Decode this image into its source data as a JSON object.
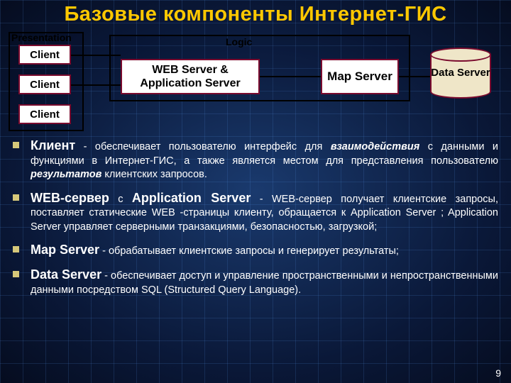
{
  "title": "Базовые компоненты Интернет-ГИС",
  "diagram": {
    "presentation_label": "Presentation",
    "logic_label": "Logic",
    "clients": [
      "Client",
      "Client",
      "Client"
    ],
    "web_app": "WEB Server & Application Server",
    "map_server": "Map Server",
    "data_server": "Data Server"
  },
  "bullets": {
    "b1_term": "Клиент",
    "b1_rest_a": " - обеспечивает пользователю интерфейс для ",
    "b1_em": "взаимодействия",
    "b1_rest_b": " с данными и функциями в Интернет-ГИС, а также является местом для представления пользователю ",
    "b1_em2": "результатов",
    "b1_rest_c": " клиентских запросов.",
    "b2_term": "WEB-сервер",
    "b2_mid": " с ",
    "b2_term2": "Application Server",
    "b2_rest": " - WEB-сервер получает клиентские запросы, поставляет статические WEB -страницы клиенту, обращается к Application Server ; Application Server управляет серверными транзакциями, безопасностью, загрузкой;",
    "b3_term": "Map Server",
    "b3_rest": " - обрабатывает клиентские запросы и генерирует результаты;",
    "b4_term": "Data Server",
    "b4_rest": " - обеспечивает доступ и управление пространственными и непространственными данными посредством SQL (Structured Query Language)."
  },
  "pagenum": "9"
}
